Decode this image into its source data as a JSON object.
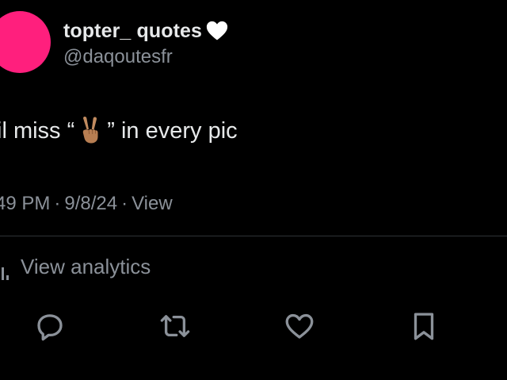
{
  "tweet": {
    "author": {
      "display_name": "topter_ quotes",
      "name_emoji": "white-heart-icon",
      "handle": "@daqoutesfr",
      "avatar_color": "#ff1f7d"
    },
    "text": {
      "prefix": "il miss “",
      "emoji": "victory-hand-icon",
      "suffix": "” in every pic"
    },
    "meta": {
      "time": "49 PM",
      "separator": "·",
      "date": "9/8/24",
      "views_label": "View"
    },
    "analytics": {
      "label": "View analytics",
      "icon": "bar-chart-icon"
    },
    "actions": [
      {
        "name": "reply",
        "icon": "reply-icon"
      },
      {
        "name": "repost",
        "icon": "repost-icon"
      },
      {
        "name": "like",
        "icon": "heart-outline-icon"
      },
      {
        "name": "bookmark",
        "icon": "bookmark-icon"
      }
    ]
  },
  "colors": {
    "background": "#000000",
    "primary_text": "#e7e9ea",
    "secondary_text": "#8b9199",
    "divider": "#2f3336"
  }
}
